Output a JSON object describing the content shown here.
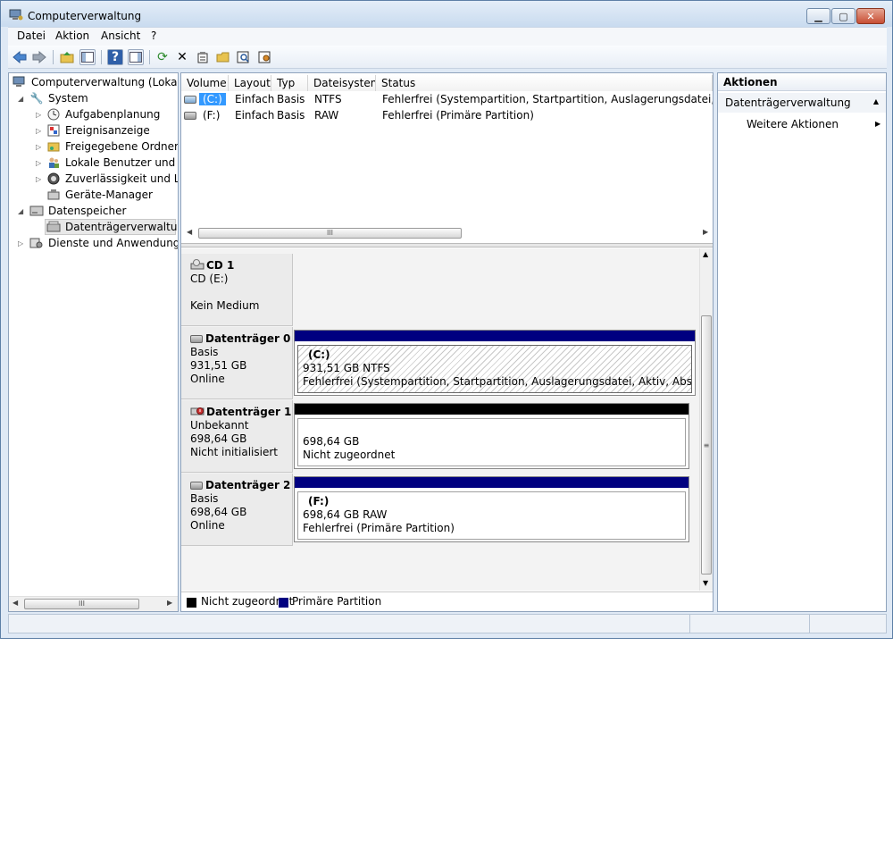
{
  "window": {
    "title": "Computerverwaltung"
  },
  "menu": {
    "items": [
      "Datei",
      "Aktion",
      "Ansicht",
      "?"
    ]
  },
  "toolbar": {
    "icons": [
      "back-arrow-icon",
      "forward-arrow-icon",
      "up-folder-icon",
      "show-hide-tree-icon",
      "help-icon",
      "show-hide-action-pane-icon",
      "refresh-icon",
      "delete-icon",
      "properties-icon",
      "open-icon",
      "search-icon",
      "settings-icon"
    ]
  },
  "tree": {
    "items": [
      {
        "label": "Computerverwaltung (Lokal)",
        "icon": "computer-management-icon"
      },
      {
        "label": "System",
        "icon": "tools-icon"
      },
      {
        "label": "Aufgabenplanung",
        "icon": "clock-icon"
      },
      {
        "label": "Ereignisanzeige",
        "icon": "event-viewer-icon"
      },
      {
        "label": "Freigegebene Ordner",
        "icon": "shared-folder-icon"
      },
      {
        "label": "Lokale Benutzer und Gru",
        "icon": "users-icon"
      },
      {
        "label": "Zuverlässigkeit und Leis",
        "icon": "performance-icon"
      },
      {
        "label": "Geräte-Manager",
        "icon": "device-manager-icon"
      },
      {
        "label": "Datenspeicher",
        "icon": "storage-icon"
      },
      {
        "label": "Datenträgerverwaltung",
        "icon": "disk-management-icon"
      },
      {
        "label": "Dienste und Anwendungen",
        "icon": "services-icon"
      }
    ]
  },
  "volumes": {
    "columns": [
      "Volume",
      "Layout",
      "Typ",
      "Dateisystem",
      "Status"
    ],
    "rows": [
      {
        "volume": "(C:)",
        "layout": "Einfach",
        "typ": "Basis",
        "fs": "NTFS",
        "status": "Fehlerfrei (Systempartition, Startpartition, Auslagerungsdatei, Aktiv, Ab"
      },
      {
        "volume": "(F:)",
        "layout": "Einfach",
        "typ": "Basis",
        "fs": "RAW",
        "status": "Fehlerfrei (Primäre Partition)"
      }
    ]
  },
  "disks": [
    {
      "name": "CD 1",
      "line1": "CD (E:)",
      "line2": "",
      "line3": "Kein Medium"
    },
    {
      "name": "Datenträger 0",
      "line1": "Basis",
      "line2": "931,51 GB",
      "line3": "Online",
      "partition": {
        "title": "(C:)",
        "size": "931,51 GB NTFS",
        "status": "Fehlerfrei (Systempartition, Startpartition, Auslagerungsdatei, Aktiv, Absturzabbild,"
      }
    },
    {
      "name": "Datenträger 1",
      "line1": "Unbekannt",
      "line2": "698,64 GB",
      "line3": "Nicht initialisiert",
      "partition": {
        "title": "",
        "size": "698,64 GB",
        "status": "Nicht zugeordnet"
      }
    },
    {
      "name": "Datenträger 2",
      "line1": "Basis",
      "line2": "698,64 GB",
      "line3": "Online",
      "partition": {
        "title": "(F:)",
        "size": "698,64 GB RAW",
        "status": "Fehlerfrei (Primäre Partition)"
      }
    }
  ],
  "legend": [
    {
      "label": "Nicht zugeordnet",
      "color": "#000000"
    },
    {
      "label": "Primäre Partition",
      "color": "#000080"
    }
  ],
  "actions": {
    "header": "Aktionen",
    "section": "Datenträgerverwaltung",
    "item": "Weitere Aktionen"
  },
  "colors": {
    "primary_partition": "#000080",
    "unallocated": "#000000",
    "selection": "#3399ff"
  }
}
